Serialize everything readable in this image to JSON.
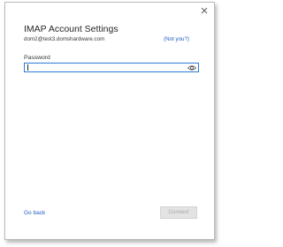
{
  "dialog": {
    "title": "IMAP Account Settings",
    "email": "dom2@test3.domshardware.com",
    "not_you_link": "(Not you?)",
    "password_label": "Password",
    "password_value": "",
    "go_back_link": "Go back",
    "connect_button": "Connect",
    "connect_enabled": false
  },
  "icons": {
    "close": "close-icon",
    "reveal_password": "eye-icon"
  },
  "colors": {
    "link": "#1f5fbf",
    "focus_border": "#2a7ad8",
    "disabled_button_bg": "#e3e3e3",
    "disabled_button_text": "#a6a6a6"
  }
}
